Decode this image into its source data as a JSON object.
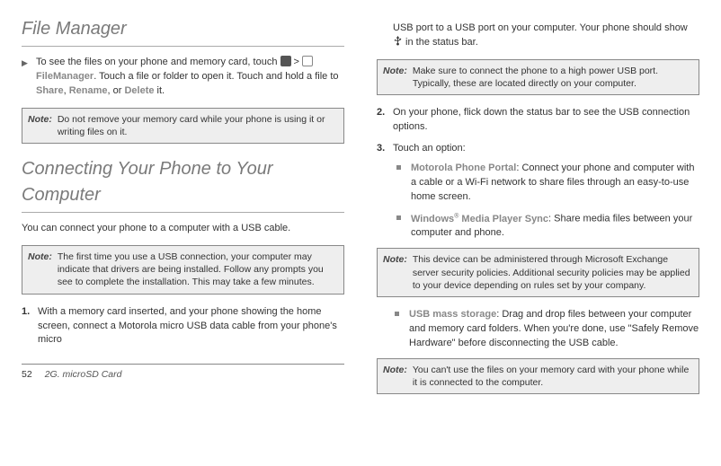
{
  "left": {
    "title1": "File Manager",
    "intro_marker": "▶",
    "intro_text_a": "To see the files on your phone and memory card, touch ",
    "intro_gt": " > ",
    "filemanager_label": " FileManager",
    "intro_text_b": ". Touch a file or folder to open it. Touch and hold a file to ",
    "share": "Share",
    "comma1": ", ",
    "rename": "Rename",
    "comma2": ", or ",
    "delete": "Delete",
    "intro_text_c": " it.",
    "note1_label": "Note:",
    "note1_text": "Do not remove your memory card while your phone is using it or writing files on it.",
    "title2": "Connecting Your Phone to Your Computer",
    "para1": "You can connect your phone to a computer with a USB cable.",
    "note2_label": "Note:",
    "note2_text": "The first time you use a USB connection, your computer may indicate that drivers are being installed. Follow any prompts you see to complete the installation. This may take a few minutes.",
    "step1_num": "1.",
    "step1_text": "With a memory card inserted, and your phone showing the home screen, connect a Motorola micro USB data cable from your phone's micro",
    "footer_page": "52",
    "footer_text": "2G. microSD Card"
  },
  "right": {
    "step1_cont_a": "USB port to a USB port on your computer. Your phone should show ",
    "step1_cont_b": " in the status bar.",
    "note3_label": "Note:",
    "note3_text": "Make sure to connect the phone to a high power USB port. Typically, these are located directly on your computer.",
    "step2_num": "2.",
    "step2_text": "On your phone, flick down the status bar to see the USB connection options.",
    "step3_num": "3.",
    "step3_text": "Touch an option:",
    "b1_title": "Motorola Phone Portal",
    "b1_text": ": Connect your phone and computer with a cable or a Wi-Fi network to share files through an easy-to-use home screen.",
    "b2_title_a": "Windows",
    "b2_title_sup": "®",
    "b2_title_b": " Media Player Sync",
    "b2_text": ": Share media files between your computer and phone.",
    "note4_label": "Note:",
    "note4_text": "This device can be administered through Microsoft Exchange server security policies. Additional security policies may be applied to your device depending on rules set by your company.",
    "b3_title": "USB mass storage",
    "b3_text": ": Drag and drop files between your computer and memory card folders. When you're done, use \"Safely Remove Hardware\" before disconnecting the USB cable.",
    "note5_label": "Note:",
    "note5_text": "You can't use the files on your memory card with your phone while it is connected to the computer."
  }
}
